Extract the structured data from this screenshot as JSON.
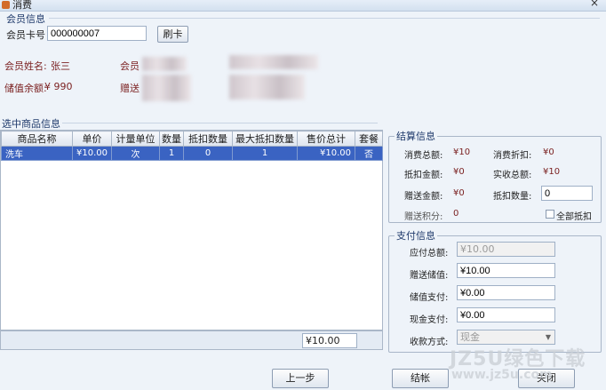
{
  "window": {
    "title": "消费"
  },
  "member": {
    "section_title": "会员信息",
    "card_label": "会员卡号",
    "card_value": "000000007",
    "swipe_button": "刷卡",
    "name_label": "会员姓名:",
    "name_value": "张三",
    "level_label": "会员",
    "balance_label": "储值余额:",
    "balance_value": "¥ 990",
    "gift_label": "赠送"
  },
  "goods": {
    "section_title": "选中商品信息",
    "columns": [
      "商品名称",
      "单价",
      "计量单位",
      "数量",
      "抵扣数量",
      "最大抵扣数量",
      "售价总计",
      "套餐"
    ],
    "rows": [
      {
        "name": "洗车",
        "price": "¥10.00",
        "unit": "次",
        "qty": "1",
        "deduct": "0",
        "max_deduct": "1",
        "total": "¥10.00",
        "package": "否"
      }
    ],
    "sum_value": "¥10.00"
  },
  "settlement": {
    "section_title": "结算信息",
    "total_label": "消费总额:",
    "total_value": "¥10",
    "discount_label": "消费折扣:",
    "discount_value": "¥0",
    "deduct_amount_label": "抵扣金额:",
    "deduct_amount_value": "¥0",
    "received_label": "实收总额:",
    "received_value": "¥10",
    "gift_amount_label": "赠送金额:",
    "gift_amount_value": "¥0",
    "deduct_qty_label": "抵扣数量:",
    "deduct_qty_value": "0",
    "gift_points_label": "赠送积分:",
    "gift_points_value": "0",
    "all_deduct_label": "全部抵扣"
  },
  "payment": {
    "section_title": "支付信息",
    "payable_label": "应付总额:",
    "payable_value": "¥10.00",
    "gift_stored_label": "赠送储值:",
    "gift_stored_value": "¥10.00",
    "stored_pay_label": "储值支付:",
    "stored_pay_value": "¥0.00",
    "cash_pay_label": "现金支付:",
    "cash_pay_value": "¥0.00",
    "method_label": "收款方式:",
    "method_value": "现金"
  },
  "footer": {
    "prev_button": "上一步",
    "settle_button": "结帐",
    "close_button": "关闭",
    "watermark": "JZ5U绿色下载",
    "watermark_url": "www.jz5u.com"
  }
}
